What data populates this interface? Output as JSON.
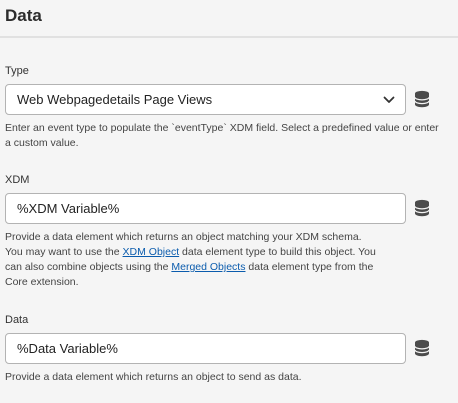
{
  "header": {
    "title": "Data"
  },
  "type_field": {
    "label": "Type",
    "value": "Web Webpagedetails Page Views",
    "help": "Enter an event type to populate the `eventType` XDM field. Select a predefined value or enter a custom value."
  },
  "xdm_field": {
    "label": "XDM",
    "value": "%XDM Variable%",
    "help_line1": "Provide a data element which returns an object matching your XDM schema.",
    "help_pre_link1": "You may want to use the ",
    "link1": "XDM Object",
    "help_post_link1": " data element type to build this object. You",
    "help_pre_link2": "can also combine objects using the ",
    "link2": "Merged Objects",
    "help_post_link2": " data element type from the",
    "help_line4": "Core extension."
  },
  "data_field": {
    "label": "Data",
    "value": "%Data Variable%",
    "help": "Provide a data element which returns an object to send as data."
  },
  "icons": {
    "dropdown": "chevron-down-icon",
    "data_element": "database-icon"
  },
  "colors": {
    "background": "#f5f5f5",
    "link": "#0b5cad",
    "border": "#b3b3b3"
  }
}
